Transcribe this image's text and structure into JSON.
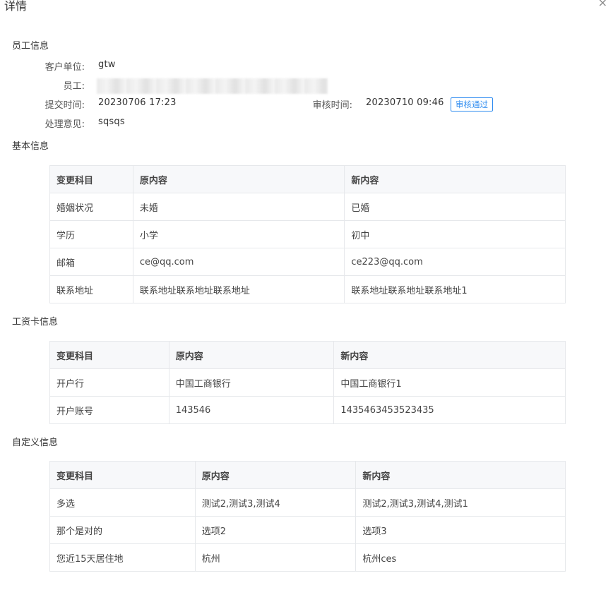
{
  "dialog": {
    "title": "详情",
    "close_glyph": "×"
  },
  "employee": {
    "section_title": "员工信息",
    "client_label": "客户单位:",
    "client_value": "gtw",
    "employee_label": "员工:",
    "submit_label": "提交时间:",
    "submit_value": "20230706 17:23",
    "review_label": "审核时间:",
    "review_value": "20230710 09:46",
    "status_badge": "审核通过",
    "opinion_label": "处理意见:",
    "opinion_value": "sqsqs"
  },
  "basic": {
    "section_title": "基本信息",
    "headers": [
      "变更科目",
      "原内容",
      "新内容"
    ],
    "rows": [
      [
        "婚姻状况",
        "未婚",
        "已婚"
      ],
      [
        "学历",
        "小学",
        "初中"
      ],
      [
        "邮箱",
        "ce@qq.com",
        "ce223@qq.com"
      ],
      [
        "联系地址",
        "联系地址联系地址联系地址",
        "联系地址联系地址联系地址1"
      ]
    ]
  },
  "salary": {
    "section_title": "工资卡信息",
    "headers": [
      "变更科目",
      "原内容",
      "新内容"
    ],
    "rows": [
      [
        "开户行",
        "中国工商银行",
        "中国工商银行1"
      ],
      [
        "开户账号",
        "143546",
        "1435463453523435"
      ]
    ]
  },
  "custom": {
    "section_title": "自定义信息",
    "headers": [
      "变更科目",
      "原内容",
      "新内容"
    ],
    "rows": [
      [
        "多选",
        "测试2,测试3,测试4",
        "测试2,测试3,测试4,测试1"
      ],
      [
        "那个是对的",
        "选项2",
        "选项3"
      ],
      [
        "您近15天居住地",
        "杭州",
        "杭州ces"
      ]
    ]
  },
  "colors": {
    "accent": "#2f8cf0",
    "header_bg": "#f7f8fa",
    "border": "#e6e8eb"
  }
}
